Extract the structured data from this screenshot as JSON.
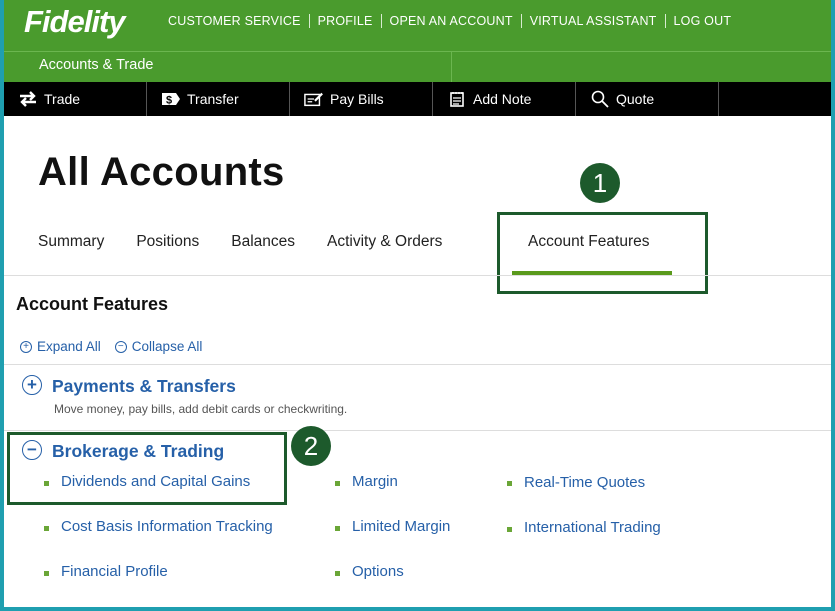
{
  "brand": "Fidelity",
  "top_nav": [
    "CUSTOMER SERVICE",
    "PROFILE",
    "OPEN AN ACCOUNT",
    "VIRTUAL ASSISTANT",
    "LOG OUT"
  ],
  "sub_nav": "Accounts & Trade",
  "toolbar": [
    {
      "label": "Trade",
      "icon": "trade-arrows-icon"
    },
    {
      "label": "Transfer",
      "icon": "dollar-transfer-icon"
    },
    {
      "label": "Pay Bills",
      "icon": "pay-bills-icon"
    },
    {
      "label": "Add Note",
      "icon": "note-icon"
    },
    {
      "label": "Quote",
      "icon": "search-icon"
    }
  ],
  "page_title": "All Accounts",
  "tabs": [
    "Summary",
    "Positions",
    "Balances",
    "Activity & Orders",
    "Account Features"
  ],
  "active_tab": "Account Features",
  "section_heading": "Account Features",
  "expand_all": "Expand All",
  "collapse_all": "Collapse All",
  "callouts": [
    "1",
    "2"
  ],
  "groups": [
    {
      "title": "Payments & Transfers",
      "description": "Move money, pay bills, add debit cards or checkwriting.",
      "expanded": false
    },
    {
      "title": "Brokerage & Trading",
      "expanded": true,
      "links": [
        [
          "Dividends and Capital Gains",
          "Margin",
          "Real-Time Quotes"
        ],
        [
          "Cost Basis Information Tracking",
          "Limited Margin",
          "International Trading"
        ],
        [
          "Financial Profile",
          "Options"
        ]
      ]
    }
  ],
  "colors": {
    "header_green": "#4a9b2d",
    "toolbar_black": "#000000",
    "link_blue": "#2660a8",
    "callout_green": "#1d5a2c",
    "tab_underline": "#5a9a1c"
  }
}
